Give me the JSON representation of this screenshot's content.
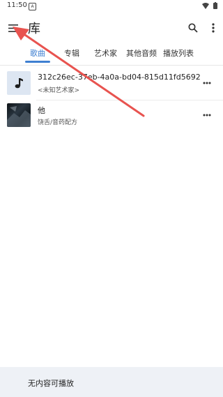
{
  "status": {
    "time": "11:50",
    "notif_icon": "A"
  },
  "app_bar": {
    "title": "库"
  },
  "tabs": [
    {
      "label": "歌曲",
      "active": true
    },
    {
      "label": "专辑",
      "active": false
    },
    {
      "label": "艺术家",
      "active": false
    },
    {
      "label": "其他音频",
      "active": false
    },
    {
      "label": "播放列表",
      "active": false
    }
  ],
  "songs": [
    {
      "title": "312c26ec-37eb-4a0a-bd04-815d11fd5692",
      "artist": "<未知艺术家>",
      "thumbnail": "music-note-icon"
    },
    {
      "title": "他",
      "artist": "饶舌/音药配方",
      "thumbnail": "album-cover"
    }
  ],
  "player": {
    "status_text": "无内容可播放"
  },
  "colors": {
    "accent": "#3e7fd1",
    "annotation_arrow": "#e8534f",
    "player_bg": "#eef1f6"
  }
}
